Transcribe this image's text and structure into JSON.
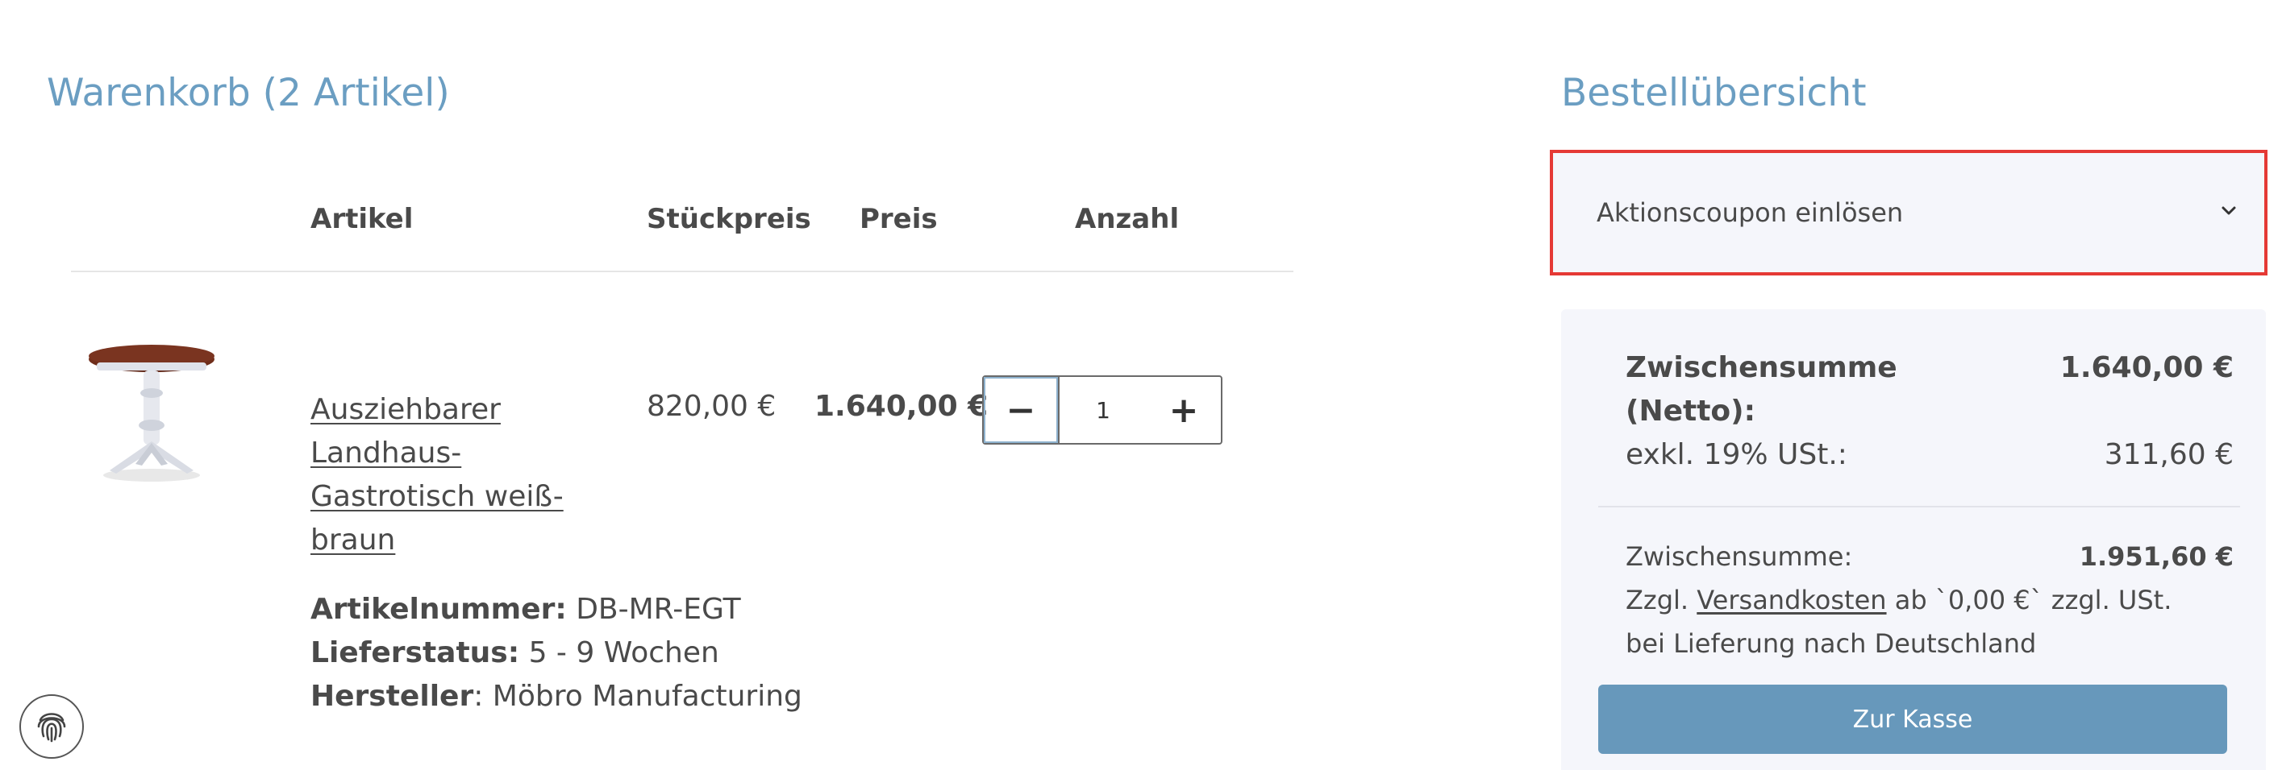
{
  "cart": {
    "title": "Warenkorb (2 Artikel)",
    "columns": {
      "artikel": "Artikel",
      "stueckpreis": "Stückpreis",
      "preis": "Preis",
      "anzahl": "Anzahl"
    },
    "items": [
      {
        "name": "Ausziehbarer Landhaus-Gastrotisch weiß-braun",
        "unit_price": "820,00 €",
        "total_price": "1.640,00 €",
        "quantity": "1",
        "quantity_minus": "−",
        "quantity_plus": "+",
        "article_number_label": "Artikelnummer:",
        "article_number": "DB-MR-EGT",
        "delivery_label": "Lieferstatus:",
        "delivery_status": "5 - 9 Wochen",
        "manufacturer_label": "Hersteller",
        "manufacturer": ": Möbro Manufacturing"
      }
    ]
  },
  "summary": {
    "title": "Bestellübersicht",
    "coupon_label": "Aktionscoupon einlösen",
    "subtotal_net_label": "Zwischensumme (Netto):",
    "subtotal_net_value": "1.640,00 €",
    "tax_label": "exkl. 19% USt.:",
    "tax_value": "311,60 €",
    "subtotal_gross_label": "Zwischensumme:",
    "subtotal_gross_value": "1.951,60 €",
    "shipping_prefix": "Zzgl. ",
    "shipping_link": "Versandkosten",
    "shipping_suffix": " ab `0,00 €` zzgl. USt. bei Lieferung nach Deutschland",
    "checkout_label": "Zur Kasse"
  },
  "colors": {
    "accent": "#6b9ec2",
    "button": "#6798bb",
    "highlight": "#e53935",
    "panel": "#f5f6fb"
  },
  "icons": {
    "coupon_toggle": "chevron-down-icon",
    "floating": "fingerprint-icon"
  }
}
